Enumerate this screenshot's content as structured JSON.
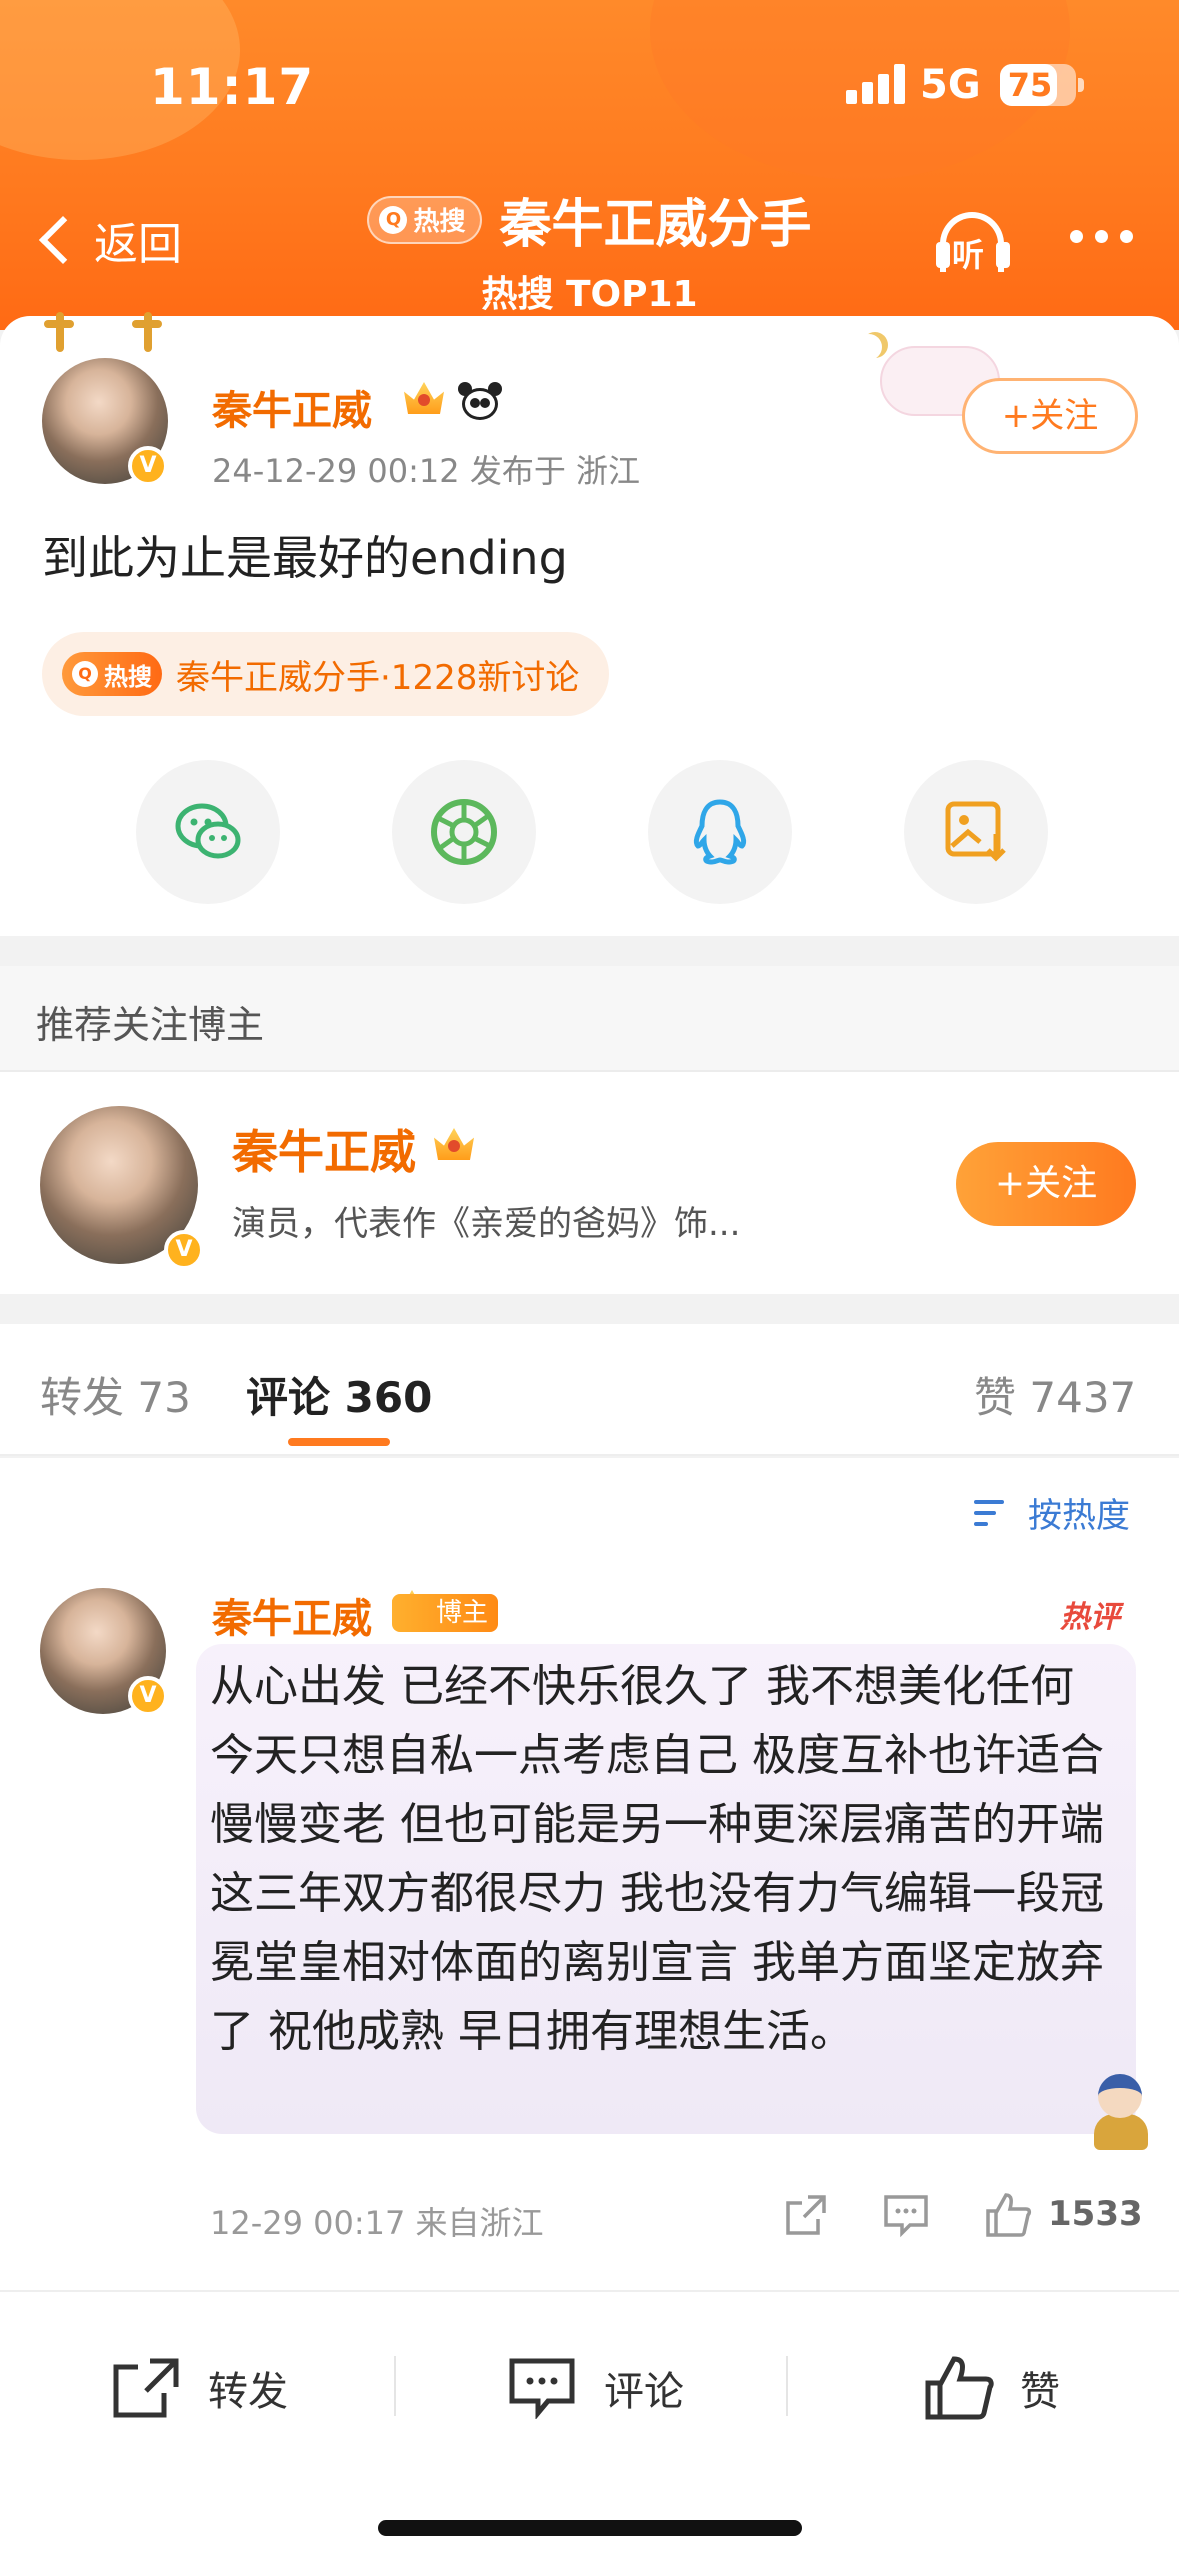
{
  "status_bar": {
    "time": "11:17",
    "network": "5G",
    "battery": "75",
    "battery_level_pct": 75
  },
  "nav": {
    "back_label": "返回",
    "hot_tag": "热搜",
    "title": "秦牛正威分手",
    "subtitle": "热搜 TOP11",
    "listen_label": "听"
  },
  "post": {
    "author": "秦牛正威",
    "meta": "24-12-29 00:12  发布于 浙江",
    "follow_label": "+关注",
    "text": "到此为止是最好的ending",
    "hot_pill_tag": "热搜",
    "hot_pill_text": "秦牛正威分手·1228新讨论",
    "share_icons": [
      "wechat-icon",
      "moments-icon",
      "qq-icon",
      "save-image-icon"
    ]
  },
  "recommend": {
    "header": "推荐关注博主",
    "name": "秦牛正威",
    "desc": "演员，代表作《亲爱的爸妈》饰...",
    "follow_label": "+关注"
  },
  "tabs": [
    {
      "label": "转发",
      "count": "73"
    },
    {
      "label": "评论",
      "count": "360"
    },
    {
      "label": "赞",
      "count": "7437"
    }
  ],
  "comments": {
    "sort_label": "按热度",
    "items": [
      {
        "author": "秦牛正威",
        "tag": "博主",
        "hot_label": "热评",
        "text": "从心出发 已经不快乐很久了 我不想美化任何 今天只想自私一点考虑自己 极度互补也许适合慢慢变老 但也可能是另一种更深层痛苦的开端 这三年双方都很尽力 我也没有力气编辑一段冠冕堂皇相对体面的离别宣言 我单方面坚定放弃了 祝他成熟 早日拥有理想生活。",
        "meta": "12-29 00:17 来自浙江",
        "likes": "1533"
      }
    ]
  },
  "bottom_bar": {
    "repost": "转发",
    "comment": "评论",
    "like": "赞"
  },
  "colors": {
    "brand_orange": "#ff7a1f",
    "name_orange": "#f26b00",
    "link_blue": "#3b7bd4",
    "hot_red": "#e84a3c"
  }
}
